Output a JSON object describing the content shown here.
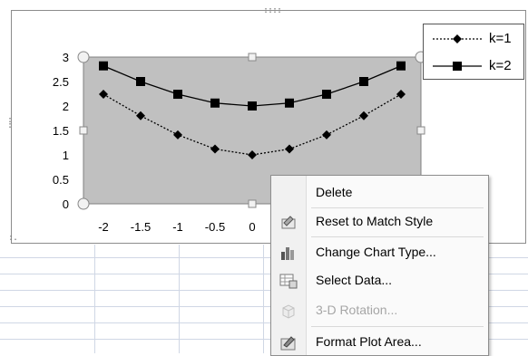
{
  "chart_data": {
    "type": "line",
    "x": [
      -2,
      -1.5,
      -1,
      -0.5,
      0,
      0.5,
      1,
      1.5,
      2
    ],
    "x_tick_labels": [
      "-2",
      "-1.5",
      "-1",
      "-0.5",
      "0"
    ],
    "y_tick_labels": [
      "0",
      "0.5",
      "1",
      "1.5",
      "2",
      "2.5",
      "3"
    ],
    "ylim": [
      0,
      3
    ],
    "xlim": [
      -2,
      2
    ],
    "series": [
      {
        "name": "k=1",
        "style": "dashed",
        "marker": "diamond",
        "values": [
          2.24,
          1.8,
          1.41,
          1.12,
          1.0,
          1.12,
          1.41,
          1.8,
          2.24
        ]
      },
      {
        "name": "k=2",
        "style": "solid",
        "marker": "square",
        "values": [
          2.82,
          2.5,
          2.24,
          2.06,
          2.0,
          2.06,
          2.24,
          2.5,
          2.82
        ]
      }
    ],
    "plot_area_color": "#c0c0c0",
    "legend_position": "top-right",
    "grid": false
  },
  "context_menu": {
    "items": [
      {
        "label": "Delete",
        "icon": "none",
        "enabled": true
      },
      {
        "label": "Reset to Match Style",
        "icon": "reset-style-icon",
        "enabled": true
      },
      {
        "label": "Change Chart Type...",
        "icon": "chart-type-icon",
        "enabled": true
      },
      {
        "label": "Select Data...",
        "icon": "select-data-icon",
        "enabled": true
      },
      {
        "label": "3-D Rotation...",
        "icon": "rotation-3d-icon",
        "enabled": false
      },
      {
        "label": "Format Plot Area...",
        "icon": "format-plot-area-icon",
        "enabled": true
      }
    ]
  }
}
